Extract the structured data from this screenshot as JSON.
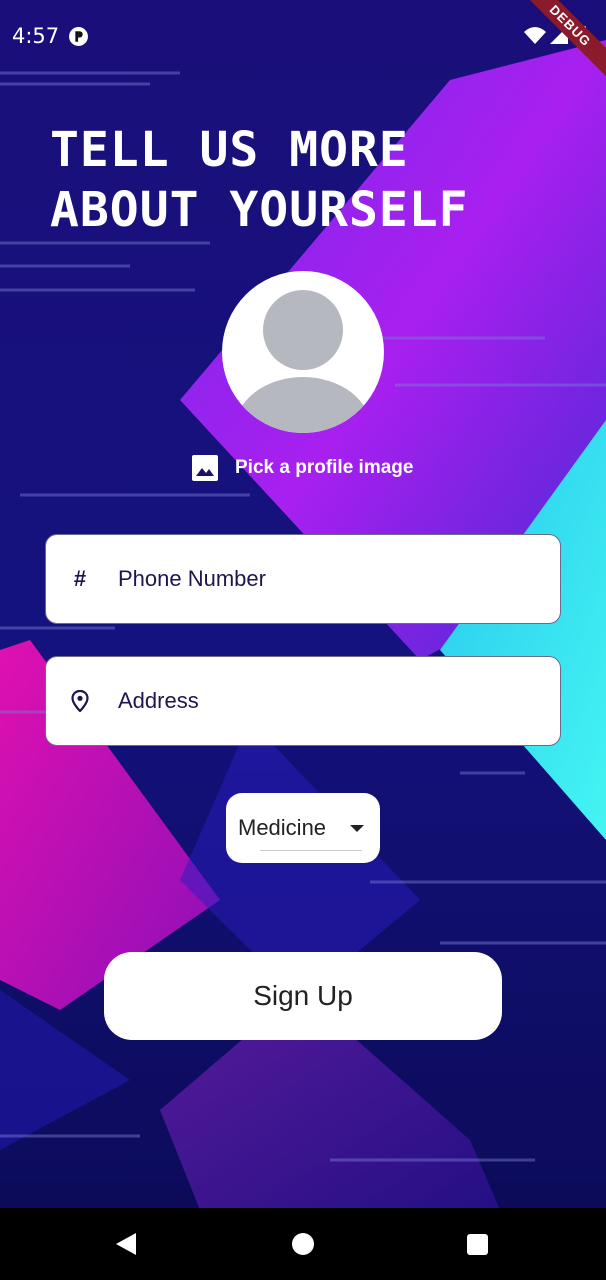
{
  "status_bar": {
    "time": "4:57",
    "app_icon": "app-p-icon",
    "icons": [
      "wifi-icon",
      "signal-icon",
      "battery-icon"
    ],
    "debug_label": "DEBUG"
  },
  "header": {
    "title_line1": "TELL US MORE",
    "title_line2": "ABOUT YOURSELF"
  },
  "profile": {
    "avatar_icon": "person-placeholder-icon",
    "pick_icon": "image-icon",
    "pick_label": "Pick a profile image"
  },
  "form": {
    "phone": {
      "icon": "hash-icon",
      "icon_glyph": "#",
      "placeholder": "Phone Number",
      "value": ""
    },
    "address": {
      "icon": "location-pin-icon",
      "placeholder": "Address",
      "value": ""
    },
    "category": {
      "selected": "Medicine",
      "icon": "caret-down-icon"
    }
  },
  "actions": {
    "signup_label": "Sign Up"
  },
  "navbar": {
    "icons": [
      "back-icon",
      "home-icon",
      "recent-apps-icon"
    ]
  },
  "colors": {
    "background_dark": "#0a0a5a",
    "accent_purple": "#a020f0",
    "accent_cyan": "#33e6f0",
    "accent_magenta": "#d010b0",
    "text_dark": "#22154f"
  }
}
